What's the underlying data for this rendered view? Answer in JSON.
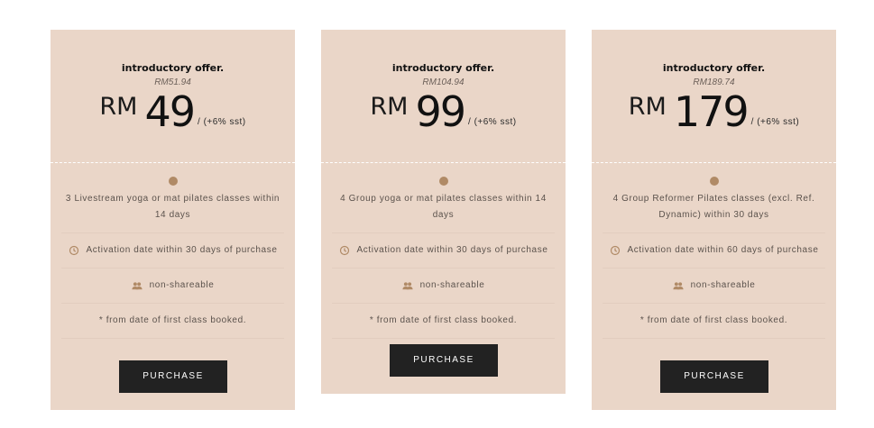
{
  "cards": [
    {
      "offer": "introductory offer.",
      "original_price": "RM51.94",
      "currency": "RM",
      "amount": "49",
      "tax": "/ (+6% sst)",
      "features": {
        "classes": "3 Livestream yoga or mat pilates classes within 14 days",
        "activation": "Activation date within 30 days of purchase",
        "share": "non-shareable",
        "note": "* from date of first class booked."
      },
      "button": "PURCHASE"
    },
    {
      "offer": "introductory offer.",
      "original_price": "RM104.94",
      "currency": "RM",
      "amount": "99",
      "tax": "/ (+6% sst)",
      "features": {
        "classes": "4 Group yoga or mat pilates classes within 14 days",
        "activation": "Activation date within 30 days of purchase",
        "share": "non-shareable",
        "note": "* from date of first class booked."
      },
      "button": "PURCHASE"
    },
    {
      "offer": "introductory offer.",
      "original_price": "RM189.74",
      "currency": "RM",
      "amount": "179",
      "tax": "/ (+6% sst)",
      "features": {
        "classes": "4 Group Reformer Pilates classes (excl. Ref. Dynamic) within 30 days",
        "activation": "Activation date within 60 days of purchase",
        "share": "non-shareable",
        "note": "* from date of first class booked."
      },
      "button": "PURCHASE"
    }
  ],
  "colors": {
    "card_bg": "#ead6c8",
    "accent": "#b08a66",
    "button_bg": "#222222"
  }
}
